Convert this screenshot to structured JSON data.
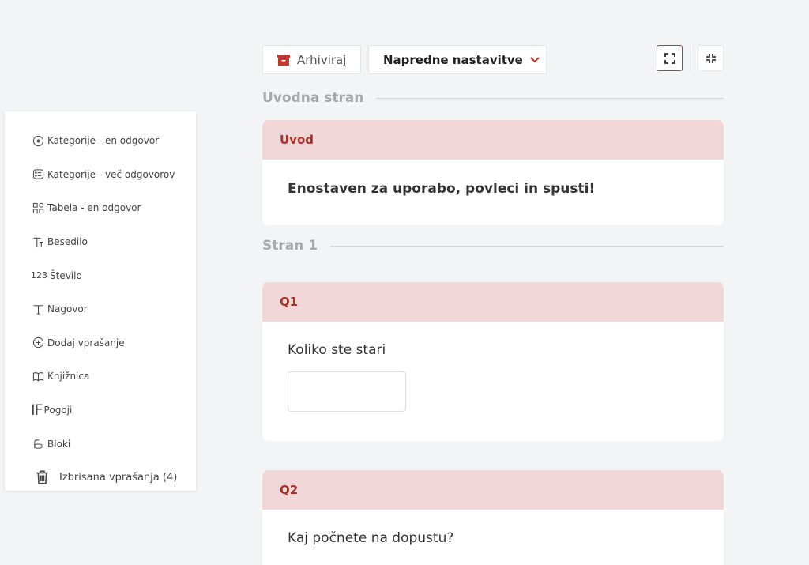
{
  "toolbar": {
    "archive_label": "Arhiviraj",
    "advanced_label": "Napredne nastavitve"
  },
  "sidebar": {
    "items": [
      {
        "label": "Kategorije - en odgovor",
        "icon": "radio-circle-icon"
      },
      {
        "label": "Kategorije - več odgovorov",
        "icon": "checklist-icon"
      },
      {
        "label": "Tabela - en odgovor",
        "icon": "grid-icon"
      },
      {
        "label": "Besedilo",
        "icon": "text-icon"
      },
      {
        "label": "Število",
        "icon": "number-icon",
        "icon_text": "123"
      },
      {
        "label": "Nagovor",
        "icon": "text-t-icon"
      },
      {
        "label": "Dodaj vprašanje",
        "icon": "plus-circle-icon"
      },
      {
        "label": "Knjižnica",
        "icon": "book-icon"
      },
      {
        "label": "Pogoji",
        "icon": "if-icon",
        "icon_text": "IF"
      },
      {
        "label": "Bloki",
        "icon": "block-icon"
      },
      {
        "label": "Izbrisana vprašanja (4)",
        "icon": "trash-icon"
      }
    ]
  },
  "sections": {
    "intro": "Uvodna stran",
    "page1": "Stran 1"
  },
  "cards": {
    "intro": {
      "title": "Uvod",
      "text": "Enostaven za uporabo, povleci in spusti!"
    },
    "q1": {
      "title": "Q1",
      "text": "Koliko ste stari",
      "value": ""
    },
    "q2": {
      "title": "Q2",
      "text": "Kaj počnete na dopustu?"
    }
  },
  "colors": {
    "accent": "#c0392b",
    "card_header_bg": "#f2d7d8",
    "card_header_text": "#a93226",
    "page_bg": "#f3f4f6"
  }
}
